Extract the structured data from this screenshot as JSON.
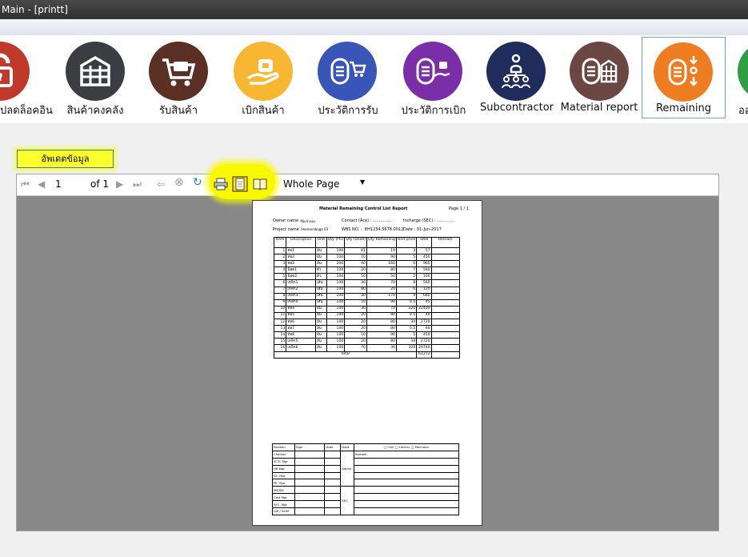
{
  "window": {
    "title": "Main - [printt]"
  },
  "ribbon": {
    "modules": [
      {
        "label": "ปลดล็อคอิน",
        "icon": "unlock-icon",
        "color": "#c0392b"
      },
      {
        "label": "สินค้าคงคลัง",
        "icon": "warehouse-shelf-icon",
        "color": "#3a3d41"
      },
      {
        "label": "รับสินค้า",
        "icon": "shopping-cart-icon",
        "color": "#5b3024"
      },
      {
        "label": "เบิกสินค้า",
        "icon": "hand-receive-icon",
        "color": "#f7b733"
      },
      {
        "label": "ประวัติการรับ",
        "icon": "receive-history-icon",
        "color": "#3a55b8"
      },
      {
        "label": "ประวัติการเบิก",
        "icon": "withdraw-history-icon",
        "color": "#7a2fa8"
      },
      {
        "label": "Subcontractor",
        "icon": "people-group-icon",
        "color": "#1f2c5c"
      },
      {
        "label": "Material report",
        "icon": "material-report-icon",
        "color": "#6a4743"
      },
      {
        "label": "Remaining",
        "icon": "remaining-icon",
        "color": "#ee7d22"
      },
      {
        "label": "ออ",
        "icon": "logout-icon",
        "color": "#2f9e44"
      }
    ],
    "selected": "Remaining"
  },
  "update_button": {
    "label": "อัพเดตข้อมูล"
  },
  "viewer": {
    "page_current": "1",
    "page_of_label": "of",
    "page_total": "1",
    "zoom": "Whole Page",
    "highlight_color": "#f8f800"
  },
  "report": {
    "title": "Material Remaining Control List Report",
    "page_label": "Page 1 / 1",
    "owner_label": "Owner name :",
    "owner_value": "ชื่อเจ้าของ",
    "contact_label": "Contact (Ace) : ...............",
    "incharge_label": "Incharge (SEC) : ..............",
    "project_label": "Project name :",
    "project_value": "Hamanabage 03",
    "wbs_label": "WBS NO. :",
    "wbs_value": "EH1234.5678.0012",
    "date_label": "Date :",
    "date_value": "01-Jun-2017",
    "columns": [
      "Item",
      "Description",
      "Unit",
      "Qty (PO)",
      "Qty (Used)",
      "Qty Remaining",
      "Unit price",
      "Total",
      "Remark"
    ],
    "rows": [
      [
        "1",
        "ท่อ1",
        "อัน",
        "100",
        "81",
        "19",
        "3",
        "57"
      ],
      [
        "2",
        "ท่อ2",
        "อัน",
        "100",
        "10",
        "90",
        "5",
        "450"
      ],
      [
        "3",
        "ท่อ3",
        "อัน",
        "200",
        "40",
        "160",
        "6",
        "960"
      ],
      [
        "4",
        "น็อต1",
        "ตัว",
        "100",
        "20",
        "80",
        "7",
        "560"
      ],
      [
        "5",
        "น็อต2",
        "ตัว",
        "100",
        "50",
        "50",
        "2",
        "100"
      ],
      [
        "6",
        "เหล็ก1",
        "เส้น",
        "100",
        "30",
        "70",
        "8",
        "560"
      ],
      [
        "7",
        "เหล็ก2",
        "เส้น",
        "100",
        "80",
        "20",
        "6",
        "120"
      ],
      [
        "8",
        "เหล็ก3",
        "เส้น",
        "200",
        "30",
        "170",
        "4",
        "680"
      ],
      [
        "9",
        "เหล็ก4",
        "เส้น",
        "100",
        "10",
        "90",
        "0.5",
        "45"
      ],
      [
        "10",
        "ท่อ4",
        "อัน",
        "100",
        "30",
        "70",
        "320",
        "22400"
      ],
      [
        "11",
        "ท่อ5",
        "อัน",
        "100",
        "20",
        "80",
        "0.5",
        "40"
      ],
      [
        "12",
        "ท่อ6",
        "อัน",
        "100",
        "20",
        "80",
        "34",
        "2720"
      ],
      [
        "13",
        "ท่อ7",
        "อัน",
        "100",
        "20",
        "80",
        "0.5",
        "40"
      ],
      [
        "14",
        "ท่อ8",
        "อัน",
        "100",
        "10",
        "90",
        "5",
        "450"
      ],
      [
        "15",
        "เหล็ก5",
        "อัน",
        "100",
        "20",
        "80",
        "34",
        "2720"
      ],
      [
        "16",
        "เหล็ก6",
        "อัน",
        "100",
        "70",
        "30",
        "320",
        "29740"
      ]
    ],
    "total_label": "Total",
    "total_value": "61272",
    "sign_headers": [
      "Position",
      "Sign",
      "Date",
      "Dept.",
      "□ Civil  □ Electric  □ Mechanic"
    ],
    "sign_positions": [
      "Checker",
      "SCTL Mgr",
      "HR Mgr",
      "SE. Mgr",
      "PE. Mgr",
      "PM/SM",
      "Cost Mgr",
      "SEC. Mgr",
      "GM / DGM"
    ],
    "remark_label": "Remark",
    "admin_label": "Admin",
    "sec_label": "SEC"
  }
}
